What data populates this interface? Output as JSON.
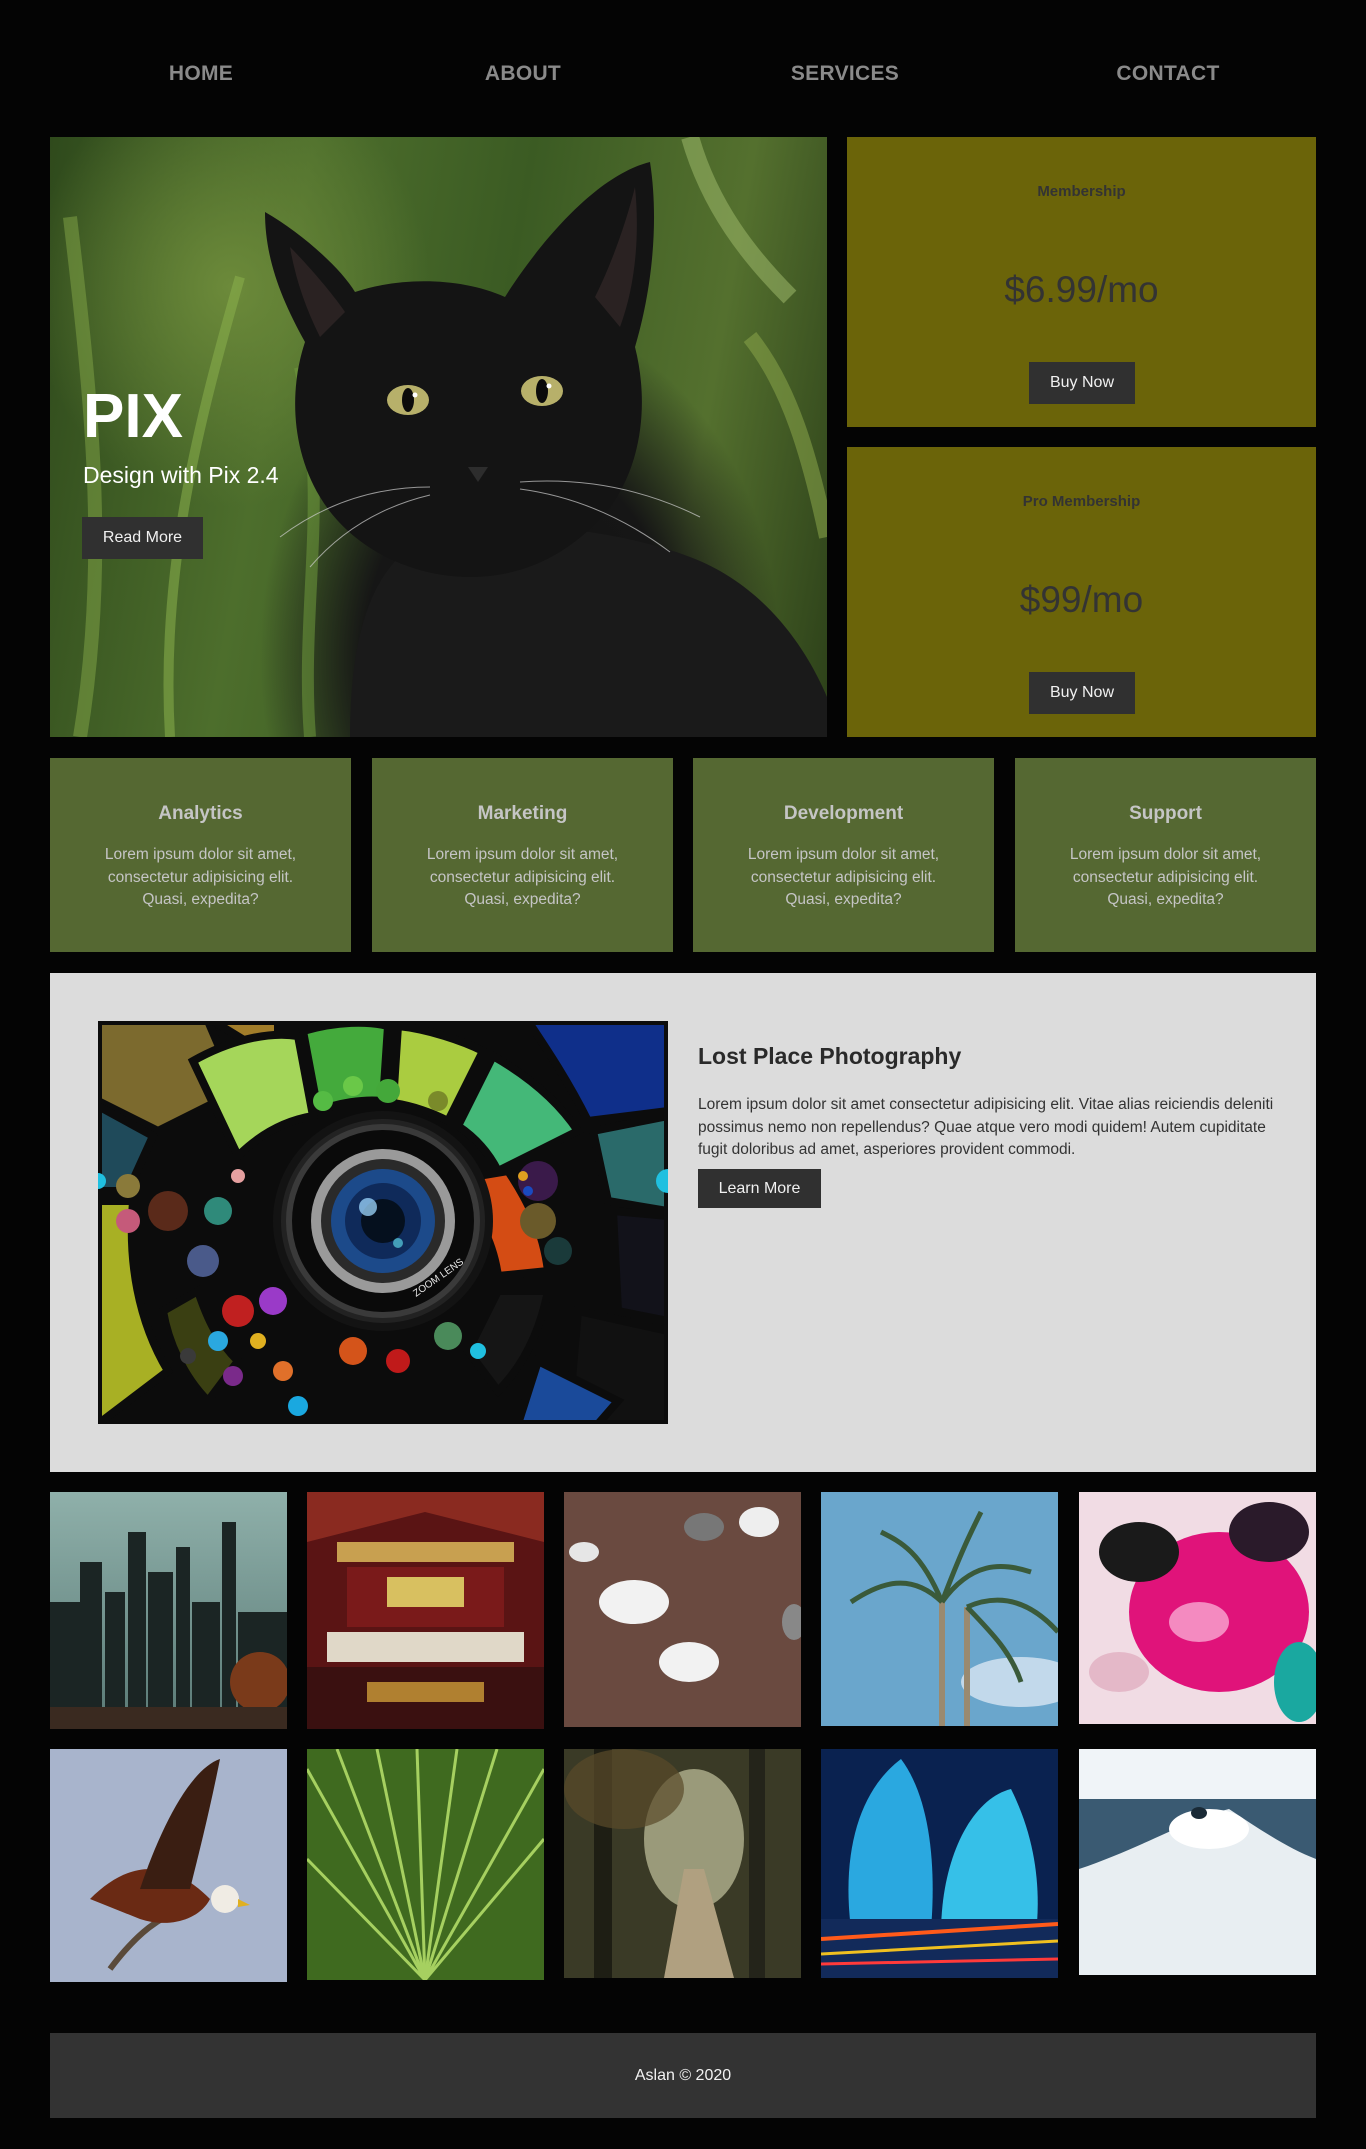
{
  "nav": {
    "items": [
      {
        "label": "HOME"
      },
      {
        "label": "ABOUT"
      },
      {
        "label": "SERVICES"
      },
      {
        "label": "CONTACT"
      }
    ]
  },
  "hero": {
    "title": "PIX",
    "subtitle": "Design with Pix 2.4",
    "button": "Read More",
    "image": "black cat"
  },
  "pricing": [
    {
      "name": "Membership",
      "price": "$6.99/mo",
      "button": "Buy Now"
    },
    {
      "name": "Pro Membership",
      "price": "$99/mo",
      "button": "Buy Now"
    }
  ],
  "services": [
    {
      "title": "Analytics",
      "text": "Lorem ipsum dolor sit amet, consectetur adipisicing elit. Quasi, expedita?"
    },
    {
      "title": "Marketing",
      "text": "Lorem ipsum dolor sit amet, consectetur adipisicing elit. Quasi, expedita?"
    },
    {
      "title": "Development",
      "text": "Lorem ipsum dolor sit amet, consectetur adipisicing elit. Quasi, expedita?"
    },
    {
      "title": "Support",
      "text": "Lorem ipsum dolor sit amet, consectetur adipisicing elit. Quasi, expedita?"
    }
  ],
  "feature": {
    "title": "Lost Place Photography",
    "text": "Lorem ipsum dolor sit amet consectetur adipisicing elit. Vitae alias reiciendis deleniti possimus nemo non repellendus? Quae atque vero modi quidem! Autem cupiditate fugit doloribus ad amet, asperiores provident commodi.",
    "button": "Learn More",
    "lens_text": "ZOOM LENS"
  },
  "colors": {
    "background": "#040404",
    "pricing_card": "#6b6409",
    "service_card": "#556832",
    "feature_bg": "#dcdcdc",
    "button": "#303030",
    "footer": "#333333"
  },
  "footer": {
    "text": "Aslan © 2020"
  }
}
